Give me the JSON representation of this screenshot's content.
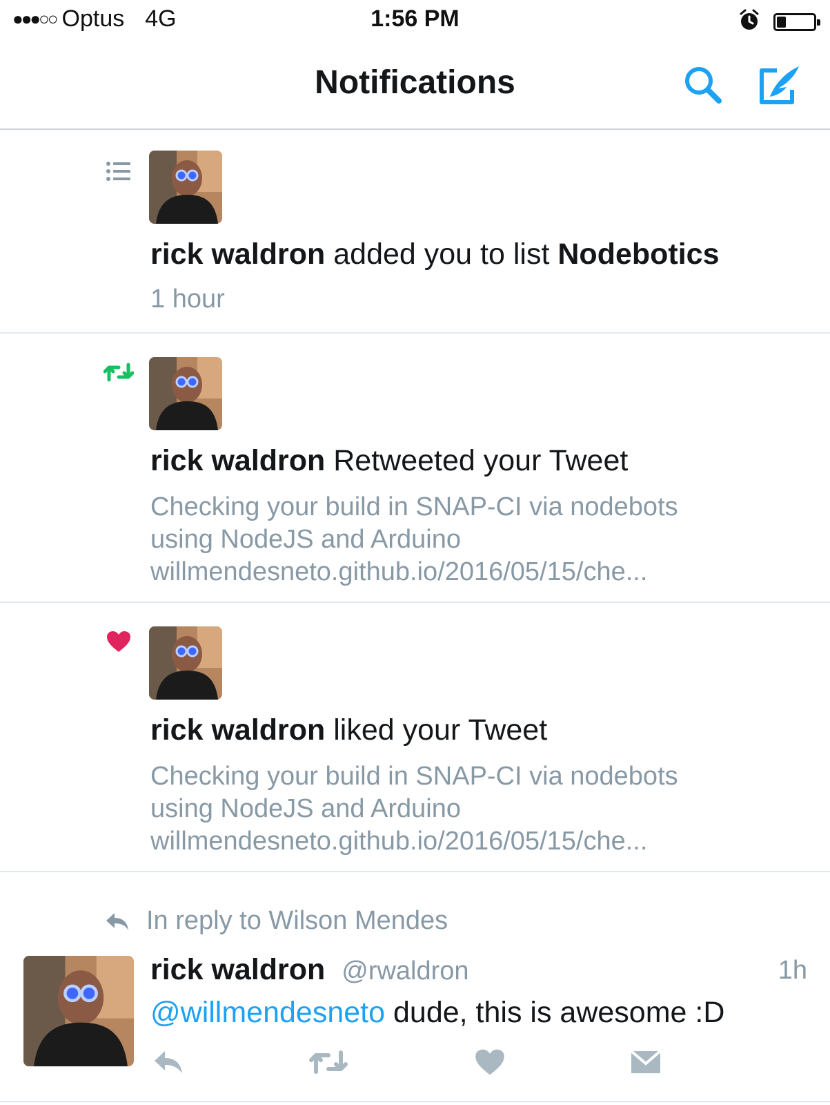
{
  "status_bar": {
    "signal": "●●●○○",
    "carrier": "Optus",
    "network": "4G",
    "time": "1:56 PM",
    "battery_level": 0.25
  },
  "header": {
    "title": "Notifications",
    "search_icon": "search-icon",
    "compose_icon": "compose-icon",
    "accent_color": "#1da1f2"
  },
  "notifications": [
    {
      "type_icon": "list-icon",
      "user": "rick waldron",
      "action": "added you to list",
      "target": "Nodebotics",
      "time": "1 hour"
    },
    {
      "type_icon": "retweet-icon",
      "icon_color": "#17bf63",
      "user": "rick waldron",
      "action": "Retweeted your Tweet",
      "tweet_line1": "Checking your build in SNAP-CI via nodebots",
      "tweet_line2": "using NodeJS and Arduino",
      "tweet_line3": "willmendesneto.github.io/2016/05/15/che..."
    },
    {
      "type_icon": "heart-icon",
      "icon_color": "#e0245e",
      "user": "rick waldron",
      "action": "liked your Tweet",
      "tweet_line1": "Checking your build in SNAP-CI via nodebots",
      "tweet_line2": "using NodeJS and Arduino",
      "tweet_line3": "willmendesneto.github.io/2016/05/15/che..."
    }
  ],
  "reply_tweet": {
    "context": "In reply to Wilson Mendes",
    "name": "rick waldron",
    "handle": "@rwaldron",
    "time": "1h",
    "mention": "@willmendesneto",
    "text": " dude, this is awesome :D",
    "actions": [
      "reply-icon",
      "retweet-icon",
      "like-icon",
      "direct-message-icon"
    ]
  }
}
